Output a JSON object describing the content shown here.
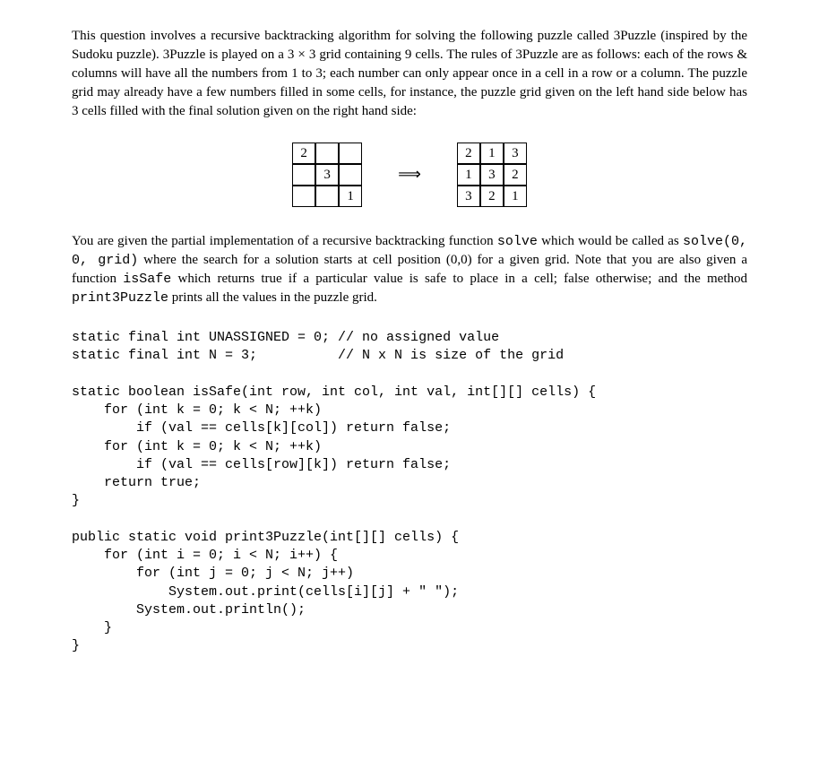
{
  "para1": {
    "t1": "This question involves a recursive backtracking algorithm for solving the following puzzle called 3Puzzle (inspired by the Sudoku puzzle). 3Puzzle is played on a 3 × 3 grid containing 9 cells. The rules of 3Puzzle are as follows: each of the rows & columns will have all the numbers from 1 to 3; each number can only appear once in a cell in a row or a column. The puzzle grid may already have a few numbers filled in some cells, for instance, the puzzle grid given on the left hand side below has 3 cells filled with the final solution given on the right hand side:"
  },
  "grids": {
    "left": [
      "2",
      "",
      "",
      "",
      "3",
      "",
      "",
      "",
      "1"
    ],
    "arrow": "⟹",
    "right": [
      "2",
      "1",
      "3",
      "1",
      "3",
      "2",
      "3",
      "2",
      "1"
    ]
  },
  "para2": {
    "t1": "You are given the partial implementation of a recursive backtracking function ",
    "c1": "solve",
    "t2": " which would be called as ",
    "c2": "solve(0, 0, grid)",
    "t3": " where the search for a solution starts at cell position (0,0) for a given grid. Note that you are also given a function ",
    "c3": "isSafe",
    "t4": " which returns true if a particular value is safe to place in a cell; false otherwise; and the method ",
    "c4": "print3Puzzle",
    "t5": " prints all the values in the puzzle grid."
  },
  "code": "static final int UNASSIGNED = 0; // no assigned value\nstatic final int N = 3;          // N x N is size of the grid\n\nstatic boolean isSafe(int row, int col, int val, int[][] cells) {\n    for (int k = 0; k < N; ++k)\n        if (val == cells[k][col]) return false;\n    for (int k = 0; k < N; ++k)\n        if (val == cells[row][k]) return false;\n    return true;\n}\n\npublic static void print3Puzzle(int[][] cells) {\n    for (int i = 0; i < N; i++) {\n        for (int j = 0; j < N; j++)\n            System.out.print(cells[i][j] + \" \");\n        System.out.println();\n    }\n}"
}
